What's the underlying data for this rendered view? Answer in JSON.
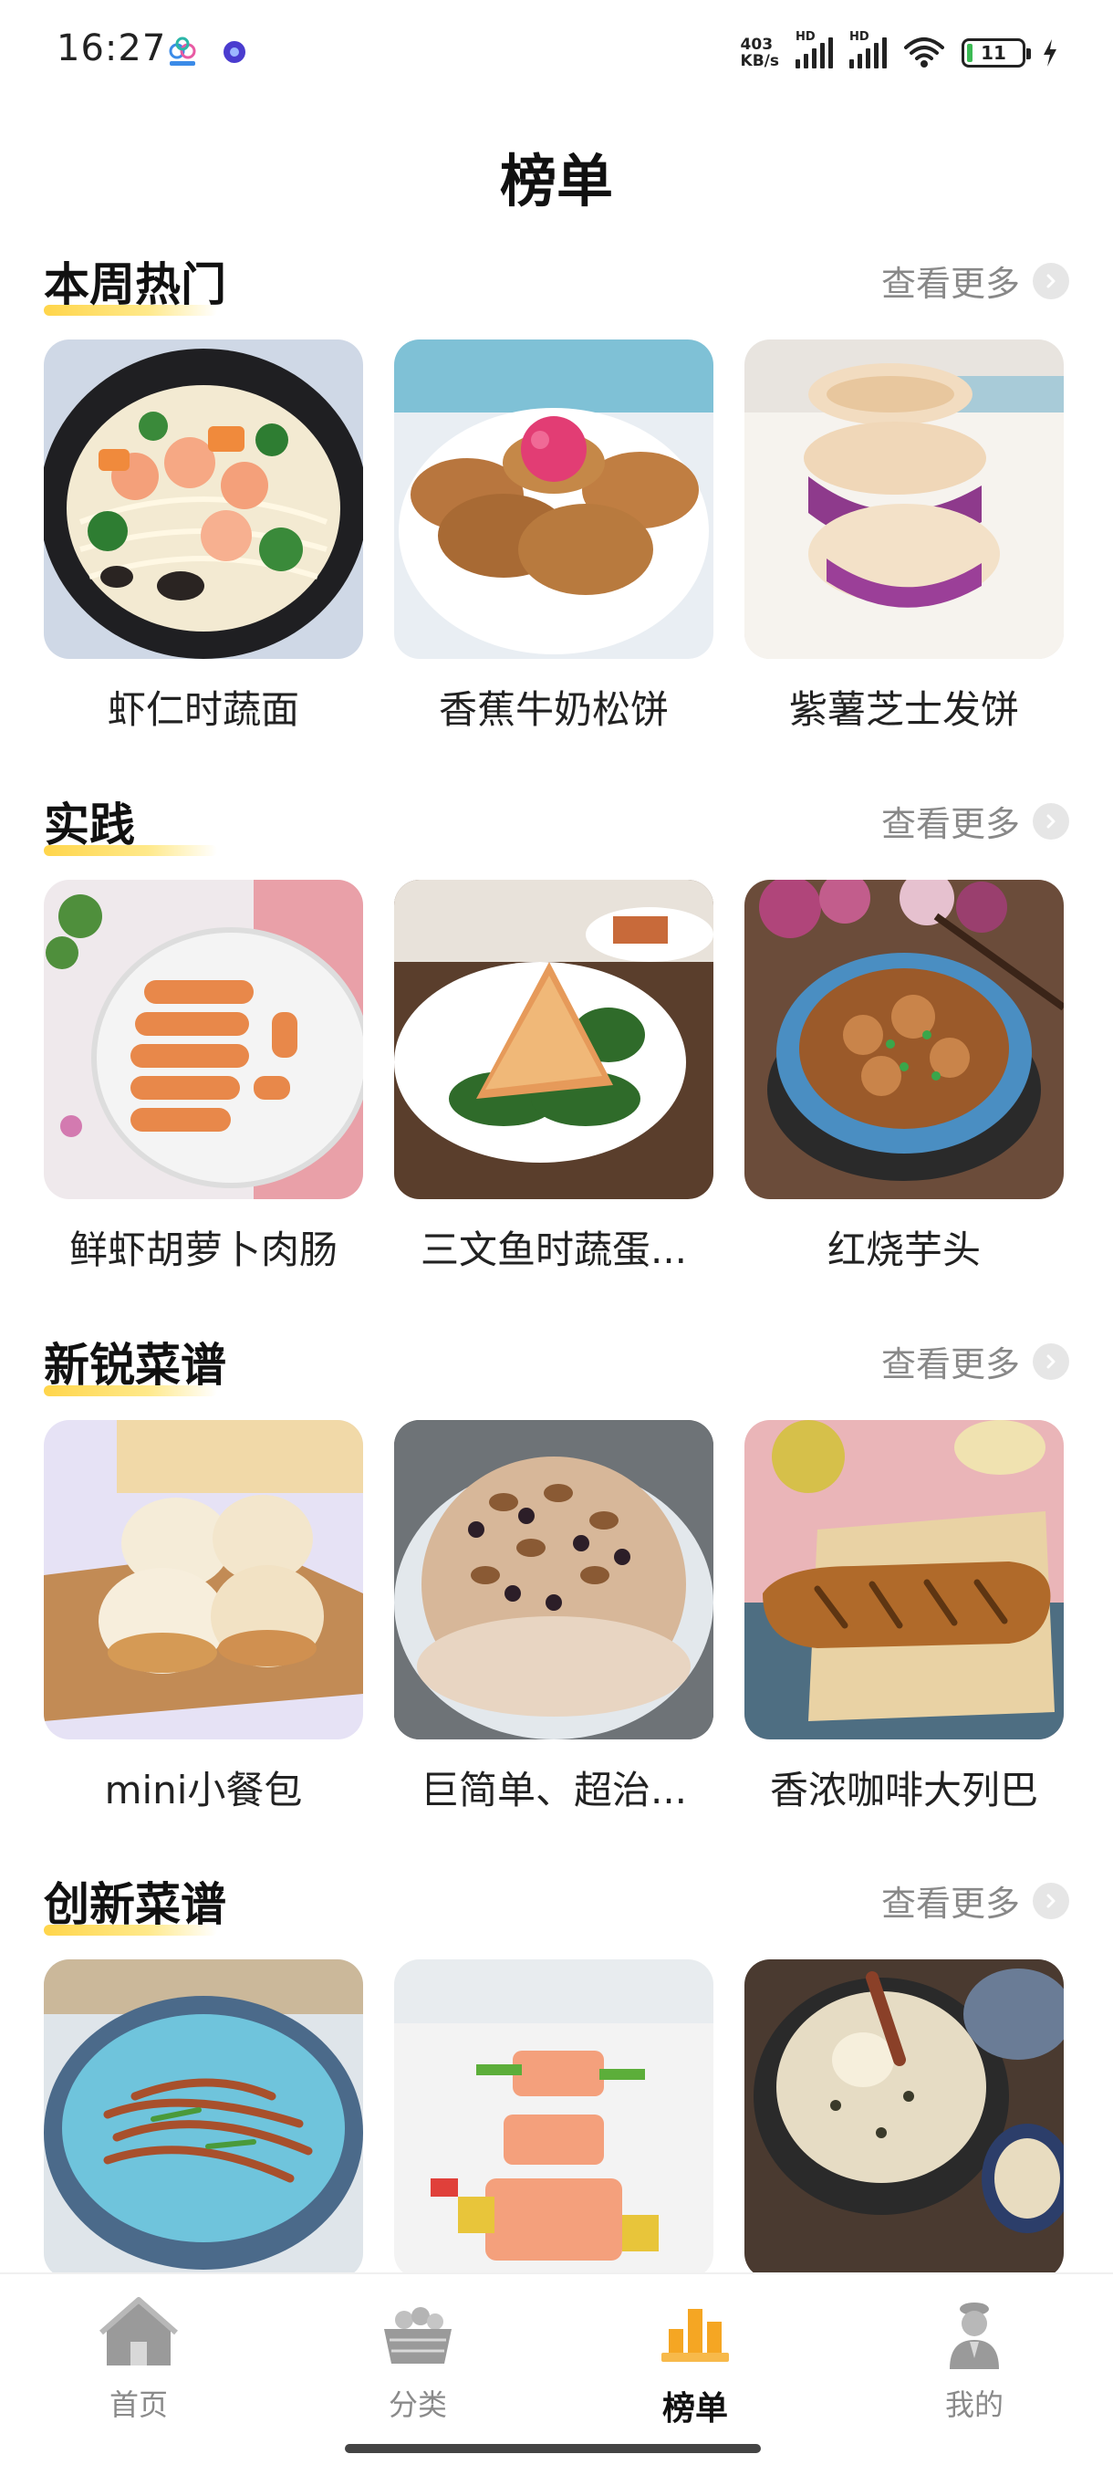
{
  "status_bar": {
    "time": "16:27",
    "net_speed_value": "403",
    "net_speed_unit": "KB/s",
    "signal_1_label": "HD",
    "signal_2_label": "HD",
    "battery": "11",
    "battery_level_percent": 11
  },
  "header": {
    "title": "榜单"
  },
  "see_more_label": "查看更多",
  "sections": [
    {
      "title": "本周热门",
      "items": [
        {
          "name": "虾仁时蔬面"
        },
        {
          "name": "香蕉牛奶松饼"
        },
        {
          "name": "紫薯芝士发饼"
        }
      ]
    },
    {
      "title": "实践",
      "items": [
        {
          "name": "鲜虾胡萝卜肉肠"
        },
        {
          "name": "三文鱼时蔬蛋..."
        },
        {
          "name": "红烧芋头"
        }
      ]
    },
    {
      "title": "新锐菜谱",
      "items": [
        {
          "name": "mini小餐包"
        },
        {
          "name": "巨简单、超治..."
        },
        {
          "name": "香浓咖啡大列巴"
        }
      ]
    },
    {
      "title": "创新菜谱",
      "items": [
        {
          "name": ""
        },
        {
          "name": ""
        },
        {
          "name": ""
        }
      ]
    }
  ],
  "tab_bar": {
    "tabs": [
      {
        "label": "首页",
        "icon": "home-icon",
        "active": false
      },
      {
        "label": "分类",
        "icon": "basket-icon",
        "active": false
      },
      {
        "label": "榜单",
        "icon": "ranking-icon",
        "active": true
      },
      {
        "label": "我的",
        "icon": "profile-icon",
        "active": false
      }
    ]
  },
  "colors": {
    "accent_yellow": "#ffd54a",
    "active_tab_icon": "#f5a623",
    "inactive_tab": "#8a8a8a"
  }
}
